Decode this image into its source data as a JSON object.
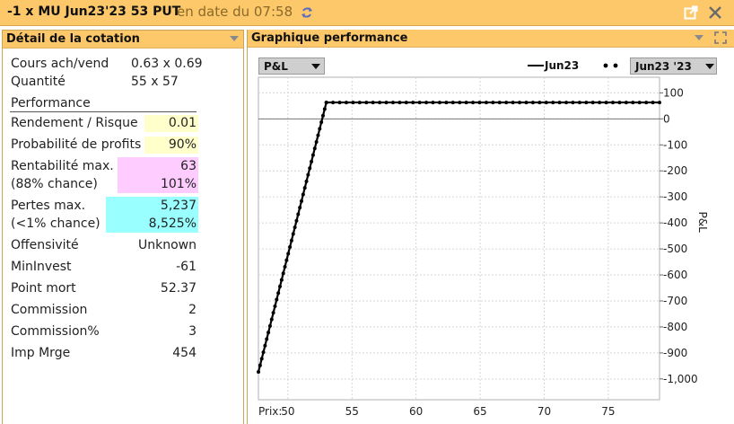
{
  "window": {
    "title": "-1 x MU Jun23'23 53 PUT",
    "subtitle": "en date du 07:58"
  },
  "quote_panel": {
    "title": "Détail de la cotation",
    "bid_ask": {
      "label": "Cours ach/vend",
      "value": "0.63 x 0.69"
    },
    "quantity": {
      "label": "Quantité",
      "value": "55 x 57"
    },
    "section": "Performance",
    "reward_risk": {
      "label": "Rendement / Risque",
      "value": "0.01"
    },
    "profit_probability": {
      "label": "Probabilité de profits",
      "value": "90%"
    },
    "max_profit": {
      "label": "Rentabilité max.",
      "chance": "(88% chance)",
      "value": "63",
      "percent": "101%"
    },
    "max_loss": {
      "label": "Pertes max.",
      "chance": "(<1% chance)",
      "value": "5,237",
      "percent": "8,525%"
    },
    "offensivity": {
      "label": "Offensivité",
      "value": "Unknown"
    },
    "min_invest": {
      "label": "MinInvest",
      "value": "-61"
    },
    "breakeven": {
      "label": "Point mort",
      "value": "52.37"
    },
    "commission": {
      "label": "Commission",
      "value": "2"
    },
    "commission_pct": {
      "label": "Commission%",
      "value": "3"
    },
    "imp_margin": {
      "label": "Imp Mrge",
      "value": "454"
    },
    "colors": {
      "yellow": "#ffffcc",
      "pink": "#ffccff",
      "cyan": "#99ffff"
    }
  },
  "chart_panel": {
    "title": "Graphique performance",
    "metric_select": "P&L",
    "legend_series": "Jun23",
    "date_select": "Jun23 '23"
  },
  "chart_data": {
    "type": "line",
    "x_label": "Prix:",
    "y_label": "P&L",
    "x_ticks": [
      50,
      55,
      60,
      65,
      70,
      75
    ],
    "y_ticks": [
      100,
      0,
      -100,
      -200,
      -300,
      -400,
      -500,
      -600,
      -700,
      -800,
      -900,
      -1000
    ],
    "y_tick_labels": [
      "100",
      "0",
      "-100",
      "-200",
      "-300",
      "-400",
      "-500",
      "-600",
      "-700",
      "-800",
      "-900",
      "-1,000"
    ],
    "xlim": [
      47.7,
      79
    ],
    "ylim": [
      -1080,
      160
    ],
    "grid": true,
    "series": [
      {
        "name": "Jun23",
        "color": "#000000",
        "style": "solid-with-dots",
        "x": [
          47.7,
          53,
          79
        ],
        "y": [
          -973,
          63,
          63
        ]
      }
    ],
    "zero_line": 0
  }
}
